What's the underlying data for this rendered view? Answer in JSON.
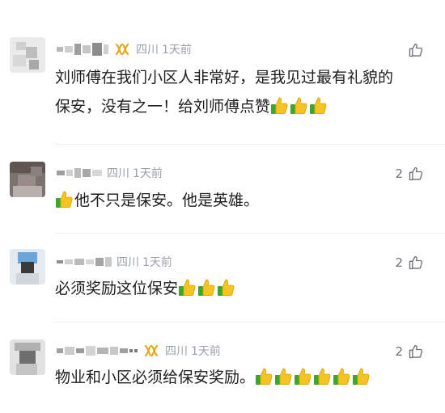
{
  "comments": [
    {
      "location": "四川",
      "time": "1天前",
      "likes": "",
      "has_badge": true,
      "text_lines": [
        "刘师傅在我们小区人非常好，是我见过最有礼貌的",
        "保安，没有之一！给刘师傅点赞"
      ],
      "thumbs_count": 3,
      "avatar_icon": "blurred-avatar"
    },
    {
      "location": "四川",
      "time": "1天前",
      "likes": "2",
      "has_badge": false,
      "text_lines": [
        "他不只是保安。他是英雄。"
      ],
      "thumbs_leading": 1,
      "avatar_icon": "blurred-avatar"
    },
    {
      "location": "四川",
      "time": "1天前",
      "likes": "2",
      "has_badge": false,
      "text_lines": [
        "必须奖励这位保安"
      ],
      "thumbs_count": 3,
      "avatar_icon": "blurred-avatar"
    },
    {
      "location": "四川",
      "time": "1天前",
      "likes": "2",
      "has_badge": true,
      "text_lines": [
        "物业和小区必须给保安奖励。"
      ],
      "thumbs_count": 6,
      "avatar_icon": "blurred-avatar"
    }
  ],
  "icons": {
    "like": "thumbs-up-outline-icon",
    "badge": "gold-badge-icon",
    "emoji": "thumbs-up-emoji-icon"
  },
  "colors": {
    "meta": "#9aa0a8",
    "badge": "#e8a317",
    "emoji_yellow": "#f6c324",
    "emoji_green": "#3aa82e"
  }
}
